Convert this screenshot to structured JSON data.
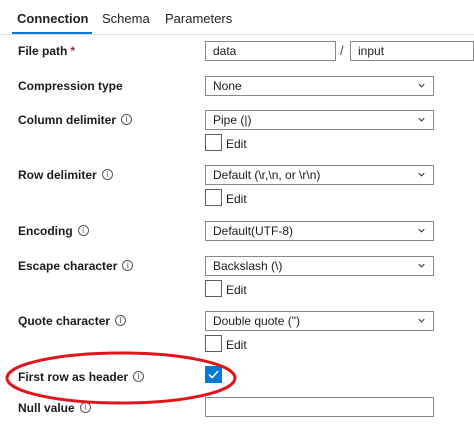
{
  "tabs": [
    {
      "label": "Connection",
      "active": true
    },
    {
      "label": "Schema",
      "active": false
    },
    {
      "label": "Parameters",
      "active": false
    }
  ],
  "file_path": {
    "label": "File path",
    "required_mark": "*",
    "container": "data",
    "separator": "/",
    "folder": "input"
  },
  "compression_type": {
    "label": "Compression type",
    "value": "None"
  },
  "column_delimiter": {
    "label": "Column delimiter",
    "value": "Pipe (|)",
    "edit_label": "Edit",
    "edit_checked": false
  },
  "row_delimiter": {
    "label": "Row delimiter",
    "value": "Default (\\r,\\n, or \\r\\n)",
    "edit_label": "Edit",
    "edit_checked": false
  },
  "encoding": {
    "label": "Encoding",
    "value": "Default(UTF-8)"
  },
  "escape_character": {
    "label": "Escape character",
    "value": "Backslash (\\)",
    "edit_label": "Edit",
    "edit_checked": false
  },
  "quote_character": {
    "label": "Quote character",
    "value": "Double quote (\")",
    "edit_label": "Edit",
    "edit_checked": false
  },
  "first_row_as_header": {
    "label": "First row as header",
    "checked": true
  },
  "null_value": {
    "label": "Null value",
    "value": ""
  },
  "info_glyph": "i",
  "colors": {
    "accent": "#0078d4",
    "highlight_ellipse": "#e0151b"
  }
}
